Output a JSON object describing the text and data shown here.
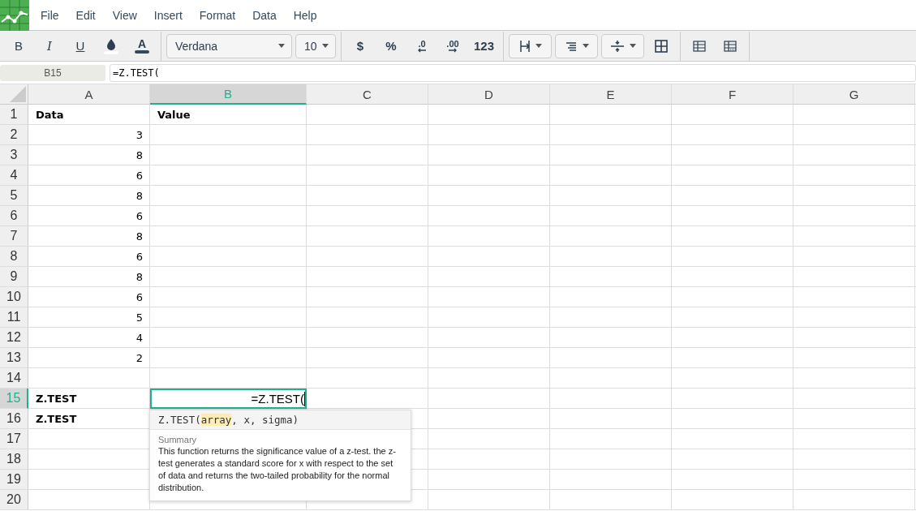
{
  "menu": [
    "File",
    "Edit",
    "View",
    "Insert",
    "Format",
    "Data",
    "Help"
  ],
  "toolbar": [
    {
      "kind": "bold",
      "label": "B"
    },
    {
      "kind": "italic",
      "label": "I"
    },
    {
      "kind": "underline",
      "label": "U"
    },
    {
      "kind": "fillcolor"
    },
    {
      "kind": "textcolor",
      "label": "A"
    },
    {
      "kind": "sep"
    },
    {
      "kind": "font",
      "value": "Verdana"
    },
    {
      "kind": "size",
      "value": "10"
    },
    {
      "kind": "sep"
    },
    {
      "kind": "format",
      "label": "$"
    },
    {
      "kind": "format",
      "label": "%"
    },
    {
      "kind": "decrease",
      "label": ".0"
    },
    {
      "kind": "increase",
      "label": ".00"
    },
    {
      "kind": "format",
      "label": "123"
    },
    {
      "kind": "sep"
    },
    {
      "kind": "halign"
    },
    {
      "kind": "textalign"
    },
    {
      "kind": "valign"
    },
    {
      "kind": "borders"
    },
    {
      "kind": "sep"
    },
    {
      "kind": "table"
    },
    {
      "kind": "tabledotted"
    },
    {
      "kind": "sep"
    }
  ],
  "formula_bar": {
    "cell_ref": "B15",
    "formula": "=Z.TEST("
  },
  "columns": [
    {
      "label": "A",
      "selected": false
    },
    {
      "label": "B",
      "selected": true
    },
    {
      "label": "C",
      "selected": false
    },
    {
      "label": "D",
      "selected": false
    },
    {
      "label": "E",
      "selected": false
    },
    {
      "label": "F",
      "selected": false
    },
    {
      "label": "G",
      "selected": false
    }
  ],
  "rows": [
    {
      "label": "1",
      "selected": false,
      "cells": [
        {
          "text": "Data",
          "bold": true
        },
        {
          "text": "Value",
          "bold": true
        }
      ]
    },
    {
      "label": "2",
      "selected": false,
      "cells": [
        {
          "text": "3",
          "kind": "number"
        }
      ]
    },
    {
      "label": "3",
      "selected": false,
      "cells": [
        {
          "text": "8",
          "kind": "number"
        }
      ]
    },
    {
      "label": "4",
      "selected": false,
      "cells": [
        {
          "text": "6",
          "kind": "number"
        }
      ]
    },
    {
      "label": "5",
      "selected": false,
      "cells": [
        {
          "text": "8",
          "kind": "number"
        }
      ]
    },
    {
      "label": "6",
      "selected": false,
      "cells": [
        {
          "text": "6",
          "kind": "number"
        }
      ]
    },
    {
      "label": "7",
      "selected": false,
      "cells": [
        {
          "text": "8",
          "kind": "number"
        }
      ]
    },
    {
      "label": "8",
      "selected": false,
      "cells": [
        {
          "text": "6",
          "kind": "number"
        }
      ]
    },
    {
      "label": "9",
      "selected": false,
      "cells": [
        {
          "text": "8",
          "kind": "number"
        }
      ]
    },
    {
      "label": "10",
      "selected": false,
      "cells": [
        {
          "text": "6",
          "kind": "number"
        }
      ]
    },
    {
      "label": "11",
      "selected": false,
      "cells": [
        {
          "text": "5",
          "kind": "number"
        }
      ]
    },
    {
      "label": "12",
      "selected": false,
      "cells": [
        {
          "text": "4",
          "kind": "number"
        }
      ]
    },
    {
      "label": "13",
      "selected": false,
      "cells": [
        {
          "text": "2",
          "kind": "number"
        }
      ]
    },
    {
      "label": "14",
      "selected": false,
      "cells": []
    },
    {
      "label": "15",
      "selected": true,
      "cells": [
        {
          "text": "Z.TEST",
          "bold": true
        },
        {
          "text": "=Z.TEST(",
          "kind": "number",
          "editing": true
        }
      ]
    },
    {
      "label": "16",
      "selected": false,
      "cells": [
        {
          "text": "Z.TEST",
          "bold": true
        }
      ]
    },
    {
      "label": "17",
      "selected": false,
      "cells": []
    },
    {
      "label": "18",
      "selected": false,
      "cells": []
    },
    {
      "label": "19",
      "selected": false,
      "cells": []
    },
    {
      "label": "20",
      "selected": false,
      "cells": []
    }
  ],
  "function_tooltip": {
    "signature": [
      {
        "text": "Z.TEST(",
        "highlighted": false
      },
      {
        "text": "array",
        "highlighted": true
      },
      {
        "text": ", x, sigma)",
        "highlighted": false
      }
    ],
    "summary_label": "Summary",
    "summary": "This function returns the significance value of a z-test. the z-test generates a standard score for x with respect to the set of data and returns the two-tailed probability for the normal distribution."
  }
}
